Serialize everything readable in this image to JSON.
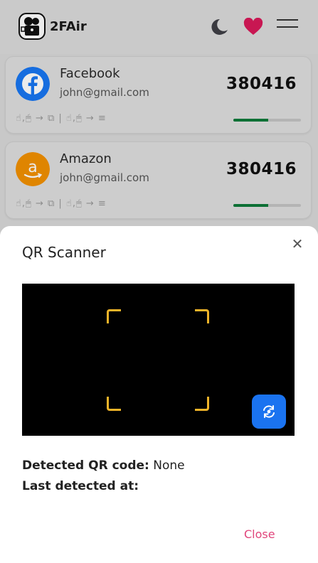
{
  "header": {
    "brand": "2FAir",
    "icons": [
      "logo-icon",
      "moon-icon",
      "heart-icon",
      "menu-icon"
    ],
    "heart_color": "#d9195a"
  },
  "accounts": [
    {
      "service": "Facebook",
      "email": "john@gmail.com",
      "code": "380416",
      "hint": "☝,🖱 → ⧉  |  ☝,🖱 → ≡",
      "icon": "facebook-icon",
      "color": "#1877f2",
      "progress": 0.52
    },
    {
      "service": "Amazon",
      "email": "john@gmail.com",
      "code": "380416",
      "hint": "☝,🖱 → ⧉  |  ☝,🖱 → ≡",
      "icon": "amazon-icon",
      "color": "#ff9900",
      "progress": 0.52
    }
  ],
  "modal": {
    "title": "QR Scanner",
    "detected_label": "Detected QR code:",
    "detected_value": "None",
    "last_label": "Last detected at:",
    "last_value": "",
    "close_label": "Close",
    "accent": "#1a73f0",
    "frame_color": "#f0b429"
  }
}
